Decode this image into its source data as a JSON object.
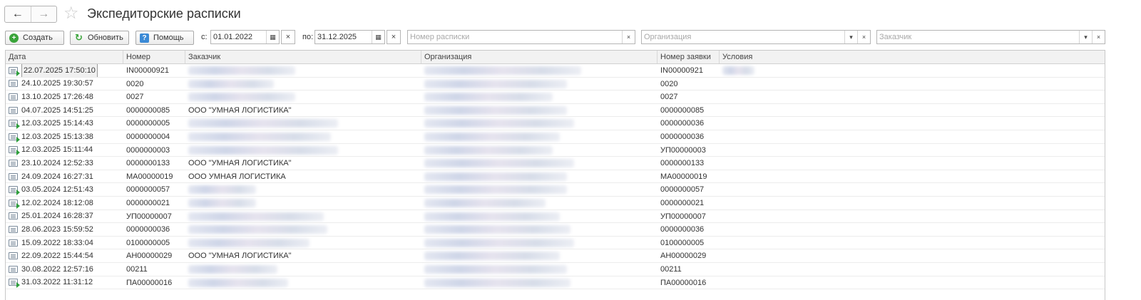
{
  "window": {
    "title": "Экспедиторские расписки"
  },
  "nav": {
    "back_icon": "arrow-left-icon",
    "forward_icon": "arrow-right-icon",
    "favorite_icon": "star-icon"
  },
  "toolbar": {
    "create_label": "Создать",
    "refresh_label": "Обновить",
    "help_label": "Помощь",
    "from_label": "с:",
    "from_value": "01.01.2022",
    "to_label": "по:",
    "to_value": "31.12.2025",
    "receipt_number_placeholder": "Номер расписки",
    "organization_placeholder": "Организация",
    "customer_placeholder": "Заказчик"
  },
  "table": {
    "columns": [
      "Дата",
      "Номер",
      "Заказчик",
      "Организация",
      "Номер заявки",
      "Условия"
    ],
    "rows": [
      {
        "date": "22.07.2025 17:50:10",
        "number": "IN00000921",
        "customer": "",
        "request": "IN00000921",
        "posted": true,
        "selected": true
      },
      {
        "date": "24.10.2025 19:30:57",
        "number": "0020",
        "customer": "",
        "request": "0020",
        "posted": false
      },
      {
        "date": "13.10.2025 17:26:48",
        "number": "0027",
        "customer": "",
        "request": "0027",
        "posted": false
      },
      {
        "date": "04.07.2025 14:51:25",
        "number": "0000000085",
        "customer": "ООО \"УМНАЯ ЛОГИСТИКА\"",
        "request": "0000000085",
        "posted": false
      },
      {
        "date": "12.03.2025 15:14:43",
        "number": "0000000005",
        "customer": "",
        "request": "0000000036",
        "posted": true
      },
      {
        "date": "12.03.2025 15:13:38",
        "number": "0000000004",
        "customer": "",
        "request": "0000000036",
        "posted": true
      },
      {
        "date": "12.03.2025 15:11:44",
        "number": "0000000003",
        "customer": "",
        "request": "УП00000003",
        "posted": true
      },
      {
        "date": "23.10.2024 12:52:33",
        "number": "0000000133",
        "customer": "ООО \"УМНАЯ ЛОГИСТИКА\"",
        "request": "0000000133",
        "posted": false
      },
      {
        "date": "24.09.2024 16:27:31",
        "number": "МА00000019",
        "customer": "ООО УМНАЯ ЛОГИСТИКА",
        "request": "МА00000019",
        "posted": false
      },
      {
        "date": "03.05.2024 12:51:43",
        "number": "0000000057",
        "customer": "",
        "request": "0000000057",
        "posted": true
      },
      {
        "date": "12.02.2024 18:12:08",
        "number": "0000000021",
        "customer": "",
        "request": "0000000021",
        "posted": true
      },
      {
        "date": "25.01.2024 16:28:37",
        "number": "УП00000007",
        "customer": "",
        "request": "УП00000007",
        "posted": false
      },
      {
        "date": "28.06.2023 15:59:52",
        "number": "0000000036",
        "customer": "",
        "request": "0000000036",
        "posted": false
      },
      {
        "date": "15.09.2022 18:33:04",
        "number": "0100000005",
        "customer": "",
        "request": "0100000005",
        "posted": false
      },
      {
        "date": "22.09.2022 15:44:54",
        "number": "АН00000029",
        "customer": "ООО \"УМНАЯ ЛОГИСТИКА\"",
        "request": "АН00000029",
        "posted": false
      },
      {
        "date": "30.08.2022 12:57:16",
        "number": "00211",
        "customer": "",
        "request": "00211",
        "posted": false
      },
      {
        "date": "31.03.2022 11:31:12",
        "number": "ПА00000016",
        "customer": "",
        "request": "ПА00000016",
        "posted": true
      }
    ]
  }
}
